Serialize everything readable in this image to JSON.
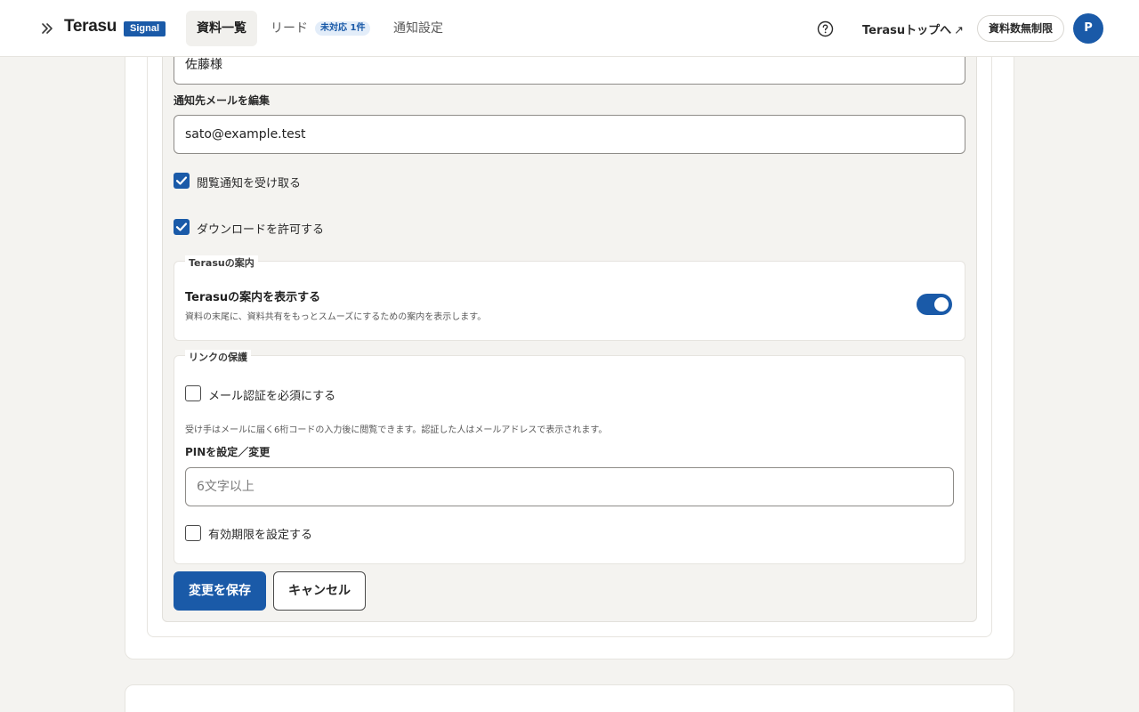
{
  "header": {
    "brand": "Terasu",
    "brand_badge": "Signal",
    "tabs": [
      {
        "label": "資料一覧"
      },
      {
        "label": "リード",
        "badge": "未対応 1件"
      },
      {
        "label": "通知設定"
      }
    ],
    "top_link": "Terasuトップへ",
    "top_link_icon": "↗",
    "plan": "資料数無制限",
    "avatar_initial": "P"
  },
  "form": {
    "name_value": "佐藤様",
    "email_label": "通知先メールを編集",
    "email_value": "sato@example.test",
    "view_notify_label": "閲覧通知を受け取る",
    "view_notify_checked": true,
    "download_label": "ダウンロードを許可する",
    "download_checked": true,
    "guide_section": {
      "legend": "Terasuの案内",
      "title": "Terasuの案内を表示する",
      "description": "資料の末尾に、資料共有をもっとスムーズにするための案内を表示します。",
      "enabled": true
    },
    "protection_section": {
      "legend": "リンクの保護",
      "email_auth_label": "メール認証を必須にする",
      "email_auth_checked": false,
      "email_auth_help": "受け手はメールに届く6桁コードの入力後に閲覧できます。認証した人はメールアドレスで表示されます。",
      "pin_label": "PINを設定／変更",
      "pin_placeholder": "6文字以上",
      "expiry_label": "有効期限を設定する",
      "expiry_checked": false
    },
    "save_label": "変更を保存",
    "cancel_label": "キャンセル"
  },
  "colors": {
    "accent": "#1a5aa8",
    "background": "#f4f3f0"
  }
}
